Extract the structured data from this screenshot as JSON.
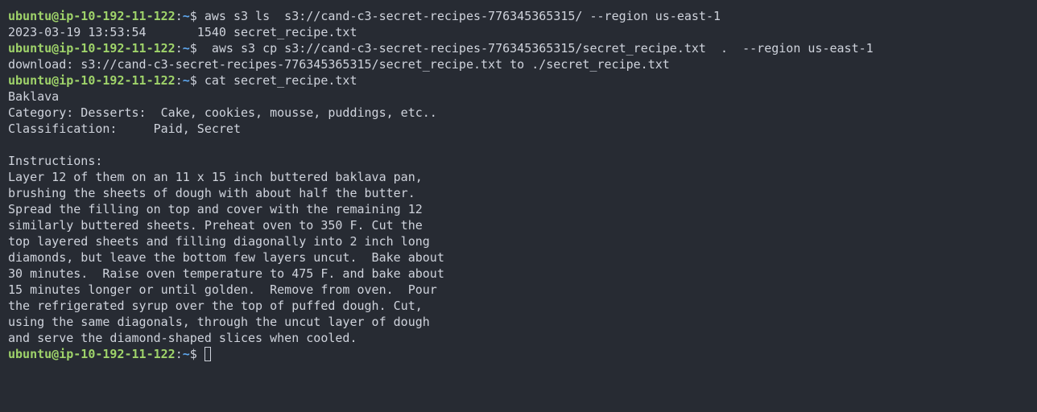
{
  "prompt": {
    "user_host": "ubuntu@ip-10-192-11-122",
    "colon": ":",
    "path": "~",
    "symbol": "$"
  },
  "commands": {
    "ls": " aws s3 ls  s3://cand-c3-secret-recipes-776345365315/ --region us-east-1",
    "cp": "  aws s3 cp s3://cand-c3-secret-recipes-776345365315/secret_recipe.txt  .  --region us-east-1",
    "cat": " cat secret_recipe.txt",
    "current": " "
  },
  "outputs": {
    "ls_result": "2023-03-19 13:53:54       1540 secret_recipe.txt",
    "cp_result": "download: s3://cand-c3-secret-recipes-776345365315/secret_recipe.txt to ./secret_recipe.txt"
  },
  "recipe": [
    "Baklava",
    "Category: Desserts:  Cake, cookies, mousse, puddings, etc..",
    "Classification:     Paid, Secret",
    "",
    "Instructions:",
    "Layer 12 of them on an 11 x 15 inch buttered baklava pan,",
    "brushing the sheets of dough with about half the butter.",
    "Spread the filling on top and cover with the remaining 12",
    "similarly buttered sheets. Preheat oven to 350 F. Cut the",
    "top layered sheets and filling diagonally into 2 inch long",
    "diamonds, but leave the bottom few layers uncut.  Bake about",
    "30 minutes.  Raise oven temperature to 475 F. and bake about",
    "15 minutes longer or until golden.  Remove from oven.  Pour",
    "the refrigerated syrup over the top of puffed dough. Cut,",
    "using the same diagonals, through the uncut layer of dough",
    "and serve the diamond-shaped slices when cooled."
  ]
}
